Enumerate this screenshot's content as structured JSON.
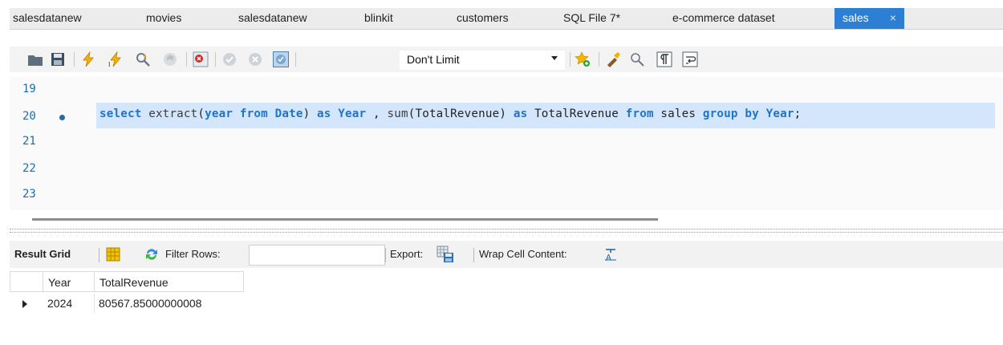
{
  "tabs": [
    {
      "label": "salesdatanew",
      "active": false
    },
    {
      "label": "movies",
      "active": false
    },
    {
      "label": "salesdatanew",
      "active": false
    },
    {
      "label": "blinkit",
      "active": false
    },
    {
      "label": "customers",
      "active": false
    },
    {
      "label": "SQL File 7*",
      "active": false
    },
    {
      "label": "e-commerce dataset",
      "active": false
    },
    {
      "label": "sales",
      "active": true,
      "close": "×"
    }
  ],
  "toolbar": {
    "limit_select": "Don't Limit",
    "icons": [
      "open-folder-icon",
      "save-icon",
      "execute-icon",
      "execute-current-icon",
      "explain-icon",
      "stop-icon",
      "error-toggle-icon",
      "commit-icon",
      "rollback-icon",
      "autocommit-icon",
      "bookmark-icon",
      "beautify-icon",
      "find-icon",
      "invisible-chars-icon",
      "wrap-icon"
    ]
  },
  "editor": {
    "line_numbers": [
      "19",
      "20",
      "21",
      "22",
      "23"
    ],
    "active_line": "20",
    "code_tokens": [
      {
        "t": "select",
        "k": "kw"
      },
      {
        "t": " ",
        "k": ""
      },
      {
        "t": "extract",
        "k": "fn"
      },
      {
        "t": "(",
        "k": ""
      },
      {
        "t": "year",
        "k": "kw"
      },
      {
        "t": " ",
        "k": ""
      },
      {
        "t": "from",
        "k": "kw"
      },
      {
        "t": " ",
        "k": ""
      },
      {
        "t": "Date",
        "k": "kw"
      },
      {
        "t": ") ",
        "k": ""
      },
      {
        "t": "as",
        "k": "kw"
      },
      {
        "t": " ",
        "k": ""
      },
      {
        "t": "Year",
        "k": "kw"
      },
      {
        "t": " , ",
        "k": ""
      },
      {
        "t": "sum",
        "k": "fn"
      },
      {
        "t": "(TotalRevenue) ",
        "k": ""
      },
      {
        "t": "as",
        "k": "kw"
      },
      {
        "t": " TotalRevenue ",
        "k": ""
      },
      {
        "t": "from",
        "k": "kw"
      },
      {
        "t": " sales ",
        "k": ""
      },
      {
        "t": "group",
        "k": "kw"
      },
      {
        "t": " ",
        "k": ""
      },
      {
        "t": "by",
        "k": "kw"
      },
      {
        "t": " ",
        "k": ""
      },
      {
        "t": "Year",
        "k": "kw"
      },
      {
        "t": ";",
        "k": ""
      }
    ]
  },
  "result_toolbar": {
    "result_grid": "Result Grid",
    "filter_rows": "Filter Rows:",
    "filter_value": "",
    "export": "Export:",
    "wrap": "Wrap Cell Content:"
  },
  "grid": {
    "columns": [
      "Year",
      "TotalRevenue"
    ],
    "rows": [
      [
        "2024",
        "80567.85000000008"
      ]
    ]
  },
  "colors": {
    "accent": "#2d7fd3",
    "keyword": "#1f74c7",
    "selection": "#d4e6fb"
  }
}
